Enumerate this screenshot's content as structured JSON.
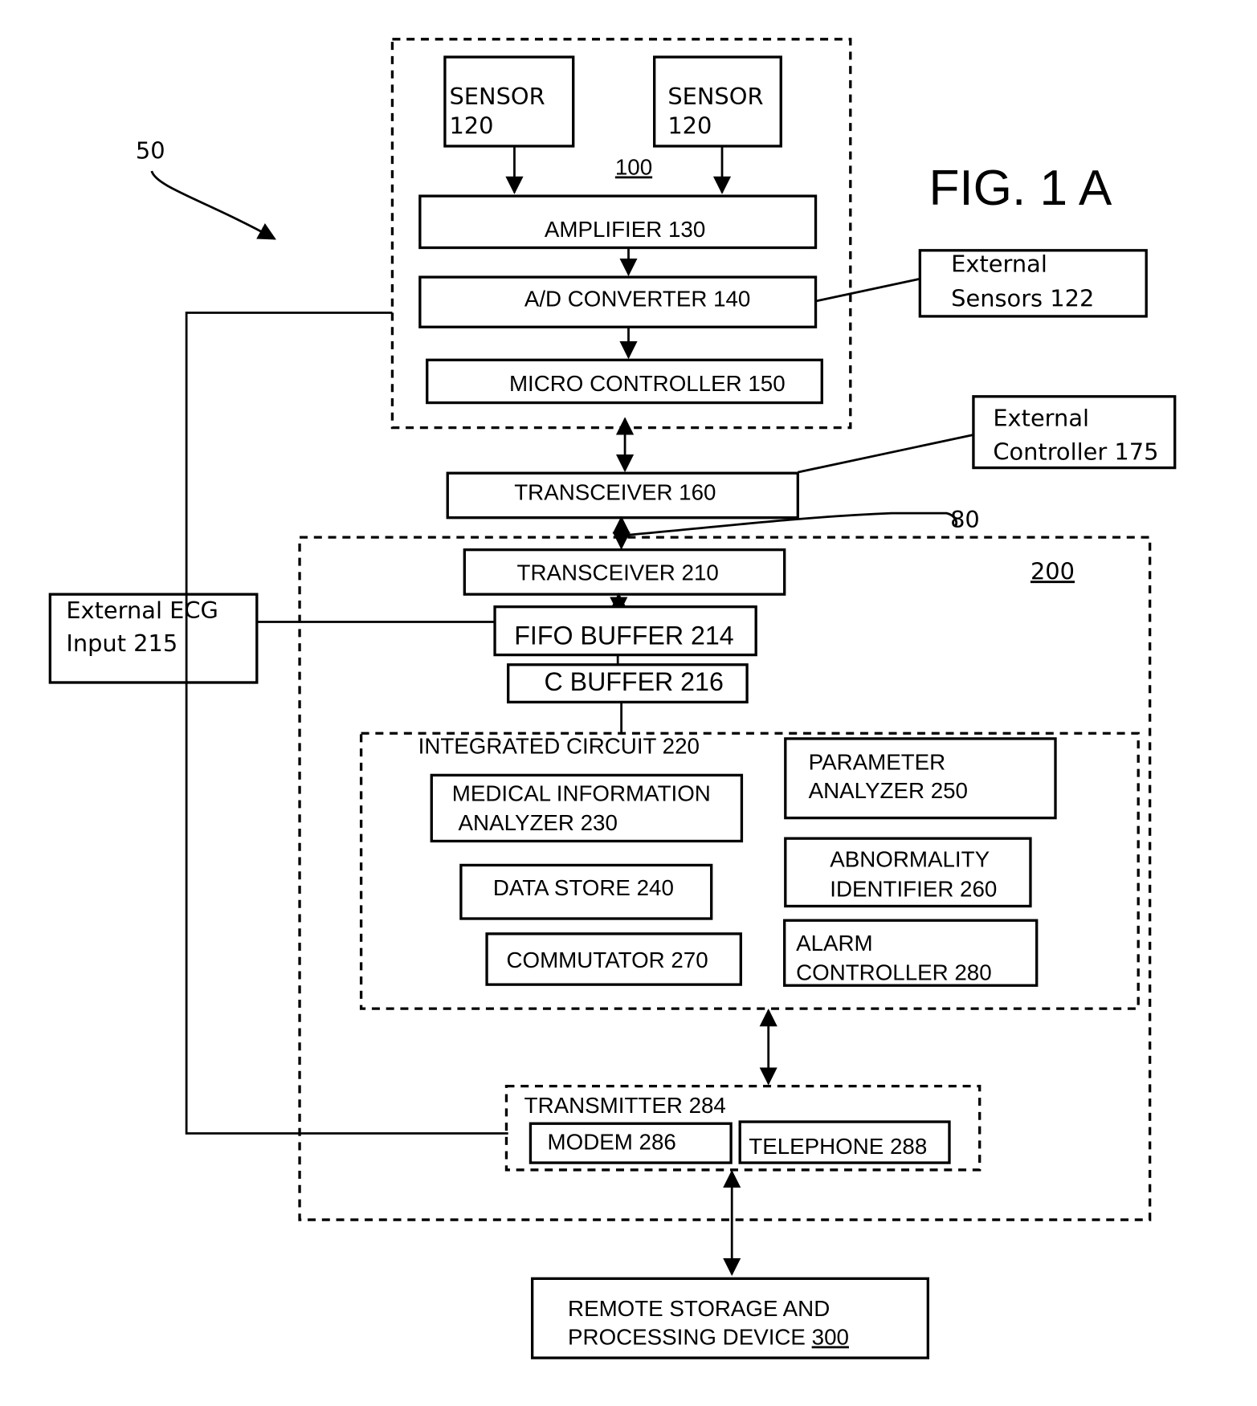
{
  "figure_label": "FIG. 1 A",
  "refs": {
    "system": "50",
    "link": "80",
    "unit_100": "100",
    "unit_200": "200"
  },
  "blocks": {
    "sensor_a": [
      "SENSOR",
      "120"
    ],
    "sensor_b": [
      "SENSOR",
      "120"
    ],
    "amplifier": "AMPLIFIER 130",
    "ad_converter": "A/D CONVERTER 140",
    "micro_controller": "MICRO CONTROLLER 150",
    "external_sensors": [
      "External",
      "Sensors  122"
    ],
    "external_controller": [
      "External",
      "Controller  175"
    ],
    "transceiver_160": "TRANSCEIVER 160",
    "transceiver_210": "TRANSCEIVER 210",
    "fifo_buffer": "FIFO BUFFER 214",
    "c_buffer": "C BUFFER 216",
    "external_ecg": [
      "External ECG",
      "Input  215"
    ],
    "integrated_circuit": "INTEGRATED CIRCUIT 220",
    "medical_info_analyzer": [
      "MEDICAL INFORMATION",
      "ANALYZER 230"
    ],
    "data_store": "DATA STORE 240",
    "commutator": "COMMUTATOR 270",
    "parameter_analyzer": [
      "PARAMETER",
      "ANALYZER 250"
    ],
    "abnormality_identifier": [
      "ABNORMALITY",
      "IDENTIFIER 260"
    ],
    "alarm_controller": [
      "ALARM",
      "CONTROLLER 280"
    ],
    "transmitter": "TRANSMITTER 284",
    "modem": "MODEM 286",
    "telephone": "TELEPHONE 288",
    "remote_storage": [
      "REMOTE STORAGE AND",
      "PROCESSING  DEVICE ",
      "300"
    ]
  }
}
